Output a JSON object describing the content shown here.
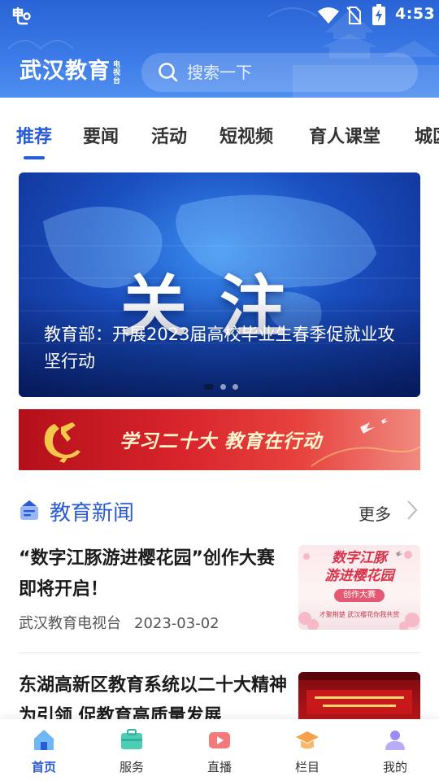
{
  "status_bar": {
    "time": "4:53"
  },
  "header": {
    "brand_name": "武汉教育",
    "brand_sub": "电视台",
    "search_placeholder": "搜索一下"
  },
  "tabs": [
    {
      "label": "推荐",
      "active": true
    },
    {
      "label": "要闻",
      "active": false
    },
    {
      "label": "活动",
      "active": false
    },
    {
      "label": "短视频",
      "active": false
    },
    {
      "label": "育人课堂",
      "active": false
    },
    {
      "label": "城区",
      "active": false
    }
  ],
  "banner": {
    "headline_word": "关注",
    "caption": "教育部：开展2023届高校毕业生春季促就业攻坚行动",
    "slide_index": 1,
    "slide_count": 3
  },
  "promo_banner": {
    "text": "学习二十大  教育在行动"
  },
  "news_section": {
    "title": "教育新闻",
    "more_label": "更多",
    "items": [
      {
        "title": "“数字江豚游进樱花园”创作大赛即将开启！",
        "source": "武汉教育电视台",
        "date": "2023-03-02",
        "thumb_text_line1": "数字江豚",
        "thumb_text_line2": "游进樱花园",
        "thumb_badge": "创作大赛",
        "thumb_footer": "才聚荆楚 武汉樱花你我共赏"
      },
      {
        "title": "东湖高新区教育系统以二十大精神为引领 促教育高质量发展",
        "source": "",
        "date": ""
      }
    ]
  },
  "bottom_nav": [
    {
      "label": "首页",
      "icon": "home-icon",
      "active": true
    },
    {
      "label": "服务",
      "icon": "services-icon",
      "active": false
    },
    {
      "label": "直播",
      "icon": "live-icon",
      "active": false
    },
    {
      "label": "栏目",
      "icon": "columns-icon",
      "active": false
    },
    {
      "label": "我的",
      "icon": "profile-icon",
      "active": false
    }
  ],
  "colors": {
    "primary": "#2a5bd7",
    "header_bg": "#3a79e6",
    "promo_red": "#d8242b"
  }
}
